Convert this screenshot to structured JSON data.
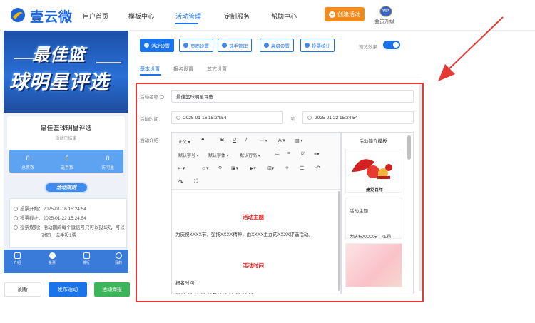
{
  "nav": {
    "logo_text": "壹云微",
    "items": [
      "用户首页",
      "模板中心",
      "活动管理",
      "定制服务",
      "帮助中心"
    ],
    "create_label": "创建活动",
    "vip_badge": "VIP",
    "vip_label": "会员升级"
  },
  "preview": {
    "banner_line1": "最佳篮",
    "banner_line2": "球明星评选",
    "activity_name": "最佳篮球明星评选",
    "status": "活动已结束",
    "stats": [
      {
        "value": "0",
        "label": "总票数"
      },
      {
        "value": "6",
        "label": "选手数"
      },
      {
        "value": "0",
        "label": "访问量"
      }
    ],
    "rules_title": "活动规则",
    "rules": [
      "投票开始：2025-01-16 15:24:54",
      "投票截止：2025-01-22 15:24:54",
      "投票规则：活动期间每个微信号只可以投1次，可以",
      "对同一选手投1票"
    ],
    "tabs": [
      "介绍",
      "投票",
      "排行",
      "我的"
    ]
  },
  "actions": {
    "refresh": "刷新",
    "publish": "发布活动",
    "poster": "活动海报"
  },
  "settings_tabs": [
    "活动设置",
    "页面设置",
    "选手管理",
    "高级设置",
    "投票统计"
  ],
  "preview_toggle_label": "预览效果",
  "sub_tabs": [
    "基本设置",
    "报名设置",
    "其它设置"
  ],
  "form": {
    "name_label": "活动名称",
    "name_value": "最佳篮球明星评选",
    "time_label": "活动时间",
    "start_time": "2025-01-16 15:24:54",
    "to_label": "至",
    "end_time": "2025-01-22 15:24:54",
    "intro_label": "活动介绍"
  },
  "editor": {
    "toolbar_row1": [
      "正文",
      "❝",
      "B",
      "U",
      "I",
      "···",
      "A",
      "▧"
    ],
    "toolbar_row2": [
      "默认字号",
      "默认字体",
      "默认行高",
      "≔",
      "≡",
      "☑",
      "≡"
    ],
    "toolbar_row3": [
      "⇤",
      "☺",
      "⚲",
      "▣",
      "▶",
      "⊞",
      "‹›",
      "☰",
      "↶"
    ],
    "toolbar_row4": [
      "↷",
      "⛶"
    ],
    "heading1": "活动主题",
    "paragraph1": "为庆祝XXXX节，弘扬XXXX精神，由XXXX主办的XXXX评选活动。",
    "heading2": "活动时间",
    "paragraph2": "报名时间：",
    "paragraph3": "2019-06-10 00:00至2019-06-20 00:00"
  },
  "templates": {
    "title": "活动简介模板",
    "item1_caption": "建党百年",
    "item2_heading": "活动主题",
    "item2_text": "为庆祝XXXX节，弘扬"
  },
  "colors": {
    "primary": "#1a73e8",
    "orange": "#f28b1e",
    "green": "#3cb55a",
    "annotation_red": "#e53935"
  }
}
